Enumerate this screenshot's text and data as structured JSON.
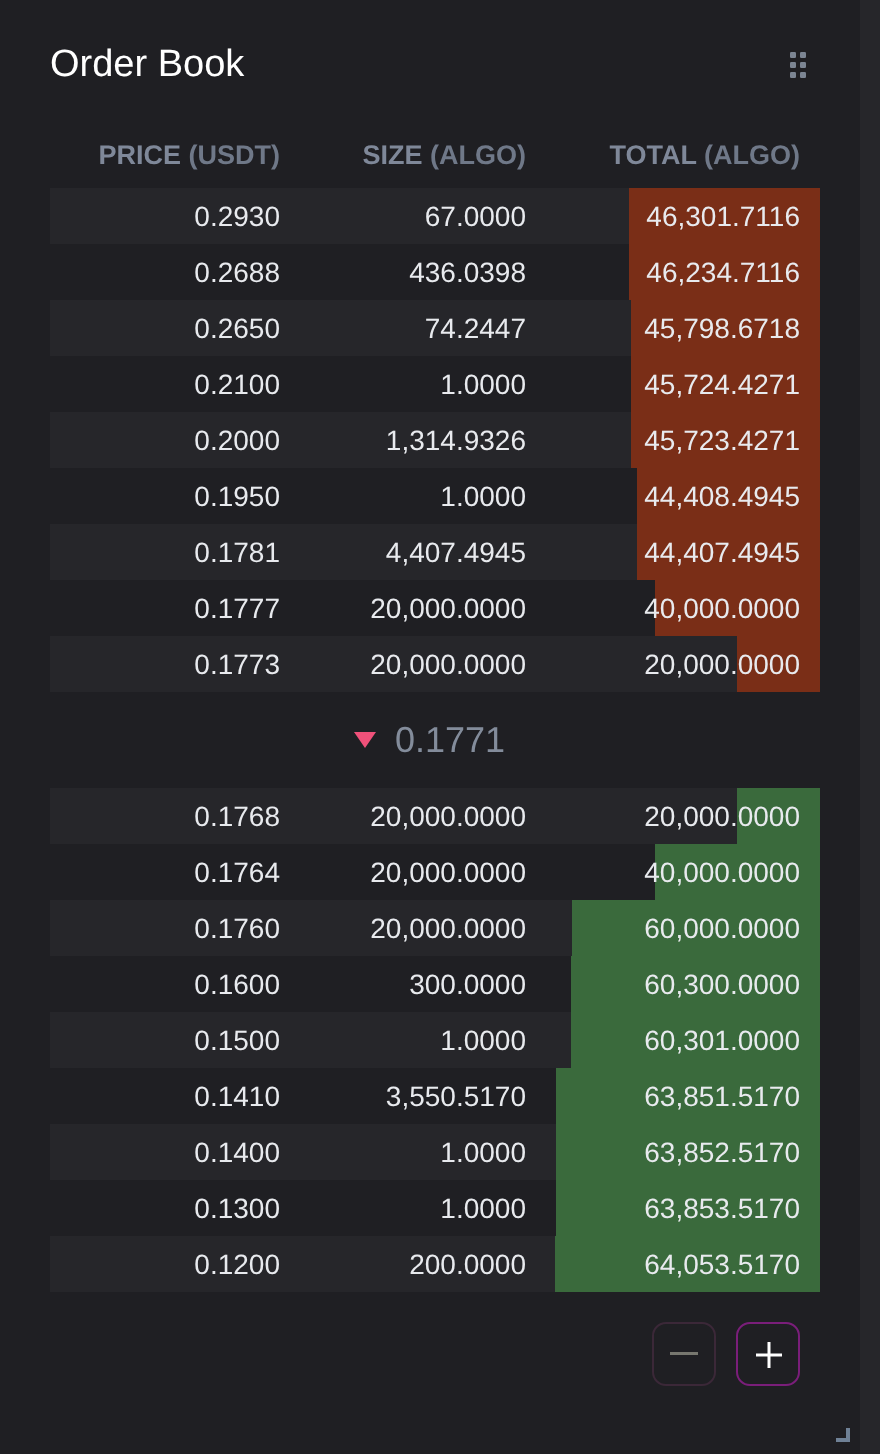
{
  "title": "Order Book",
  "columns": [
    {
      "label": "PRICE",
      "unit": "(USDT)"
    },
    {
      "label": "SIZE",
      "unit": "(ALGO)"
    },
    {
      "label": "TOTAL",
      "unit": "(ALGO)"
    }
  ],
  "asks": [
    {
      "price": "0.2930",
      "size": "67.0000",
      "total": "46,301.7116"
    },
    {
      "price": "0.2688",
      "size": "436.0398",
      "total": "46,234.7116"
    },
    {
      "price": "0.2650",
      "size": "74.2447",
      "total": "45,798.6718"
    },
    {
      "price": "0.2100",
      "size": "1.0000",
      "total": "45,724.4271"
    },
    {
      "price": "0.2000",
      "size": "1,314.9326",
      "total": "45,723.4271"
    },
    {
      "price": "0.1950",
      "size": "1.0000",
      "total": "44,408.4945"
    },
    {
      "price": "0.1781",
      "size": "4,407.4945",
      "total": "44,407.4945"
    },
    {
      "price": "0.1777",
      "size": "20,000.0000",
      "total": "40,000.0000"
    },
    {
      "price": "0.1773",
      "size": "20,000.0000",
      "total": "20,000.0000"
    }
  ],
  "last_price": {
    "value": "0.1771",
    "falling": true
  },
  "bids": [
    {
      "price": "0.1768",
      "size": "20,000.0000",
      "total": "20,000.0000"
    },
    {
      "price": "0.1764",
      "size": "20,000.0000",
      "total": "40,000.0000"
    },
    {
      "price": "0.1760",
      "size": "20,000.0000",
      "total": "60,000.0000"
    },
    {
      "price": "0.1600",
      "size": "300.0000",
      "total": "60,300.0000"
    },
    {
      "price": "0.1500",
      "size": "1.0000",
      "total": "60,301.0000"
    },
    {
      "price": "0.1410",
      "size": "3,550.5170",
      "total": "63,851.5170"
    },
    {
      "price": "0.1400",
      "size": "1.0000",
      "total": "63,852.5170"
    },
    {
      "price": "0.1300",
      "size": "1.0000",
      "total": "63,853.5170"
    },
    {
      "price": "0.1200",
      "size": "200.0000",
      "total": "64,053.5170"
    }
  ],
  "zoom_buttons": [
    {
      "kind": "minus",
      "disabled": true
    },
    {
      "kind": "plus",
      "disabled": false
    }
  ]
}
